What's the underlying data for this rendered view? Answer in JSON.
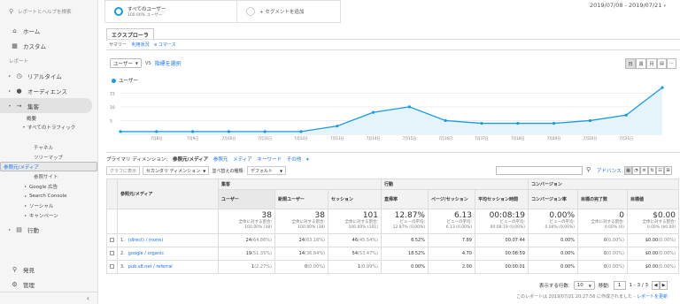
{
  "sidebar": {
    "search_placeholder": "レポートとヘルプを検索",
    "home": "ホーム",
    "custom": "カスタム",
    "reports_section": "レポート",
    "realtime": "リアルタイム",
    "audience": "オーディエンス",
    "acquisition": "集客",
    "overview": "概要",
    "all_traffic": "すべてのトラフィック",
    "channels": "チャネル",
    "treemap": "ツリーマップ",
    "source_medium": "参照元/メディア",
    "referrals": "参照サイト",
    "google_ads": "Google 広告",
    "search_console": "Search Console",
    "social": "ソーシャル",
    "campaigns": "キャンペーン",
    "behavior": "行動",
    "discover": "発見",
    "admin": "管理"
  },
  "segments": {
    "all_users_title": "すべてのユーザー",
    "all_users_sub": "100.00% ユーザー",
    "add_segment": "+ セグメントを追加"
  },
  "date_range": "2019/07/08 - 2019/07/21",
  "explorer": {
    "tab": "エクスプローラ",
    "sub_summary": "サマリー",
    "sub_usage": "利用状況",
    "sub_ecommerce": "e コマース"
  },
  "chart_controls": {
    "metric": "ユーザー",
    "vs": "VS",
    "select_metric": "指標を選択",
    "day": "日",
    "week": "週",
    "month": "月",
    "legend": "ユーザー"
  },
  "chart_data": {
    "type": "line",
    "series": [
      {
        "name": "ユーザー",
        "values": [
          1,
          1,
          1,
          1,
          1,
          1,
          3,
          8,
          10,
          5,
          4,
          4,
          4,
          5,
          7,
          17
        ]
      }
    ],
    "x": [
      "",
      "7月8日",
      "7月9日",
      "7月10日",
      "7月11日",
      "7月12日",
      "7月13日",
      "7月14日",
      "7月15日",
      "7月16日",
      "7月17日",
      "7月18日",
      "7月19日",
      "7月20日",
      "7月21日",
      ""
    ],
    "y_ticks": [
      15,
      10,
      5
    ],
    "ylim": [
      0,
      18
    ],
    "grid": true,
    "color": "#1a9be0"
  },
  "dims": {
    "primary": "プライマリ ディメンション:",
    "source_medium": "参照元/メディア",
    "source": "参照元",
    "medium": "メディア",
    "keyword": "キーワード",
    "other": "その他"
  },
  "toolbar": {
    "plot_rows": "グラフに表示",
    "secondary_dim": "セカンダリ ディメンション",
    "sort_type": "並べ替えの種類:",
    "sort_default": "デフォルト",
    "advanced": "アドバンス"
  },
  "table": {
    "dim_header": "参照元/メディア",
    "groups": {
      "acquisition": "集客",
      "behavior": "行動",
      "conversions": "コンバージョン"
    },
    "cols": [
      "ユーザー",
      "新規ユーザー",
      "セッション",
      "直帰率",
      "ページ/セッション",
      "平均セッション時間",
      "コンバージョン率",
      "目標の完了数",
      "目標値"
    ],
    "totals": [
      {
        "value": "38",
        "sub1": "全体に対する割合:",
        "sub2": "100.00% (38)"
      },
      {
        "value": "38",
        "sub1": "全体に対する割合:",
        "sub2": "100.00% (38)"
      },
      {
        "value": "101",
        "sub1": "全体に対する割合:",
        "sub2": "100.00% (101)"
      },
      {
        "value": "12.87%",
        "sub1": "ビューの平均:",
        "sub2": "12.87% (0.00%)"
      },
      {
        "value": "6.13",
        "sub1": "ビューの平均:",
        "sub2": "6.13 (0.00%)"
      },
      {
        "value": "00:08:19",
        "sub1": "ビューの平均:",
        "sub2": "00:08:19 (0.00%)"
      },
      {
        "value": "0.00%",
        "sub1": "ビューの平均:",
        "sub2": "0.00% (0.00%)"
      },
      {
        "value": "0",
        "sub1": "全体に対する割合:",
        "sub2": "0.00% (0)"
      },
      {
        "value": "$0.00",
        "sub1": "全体に対する割合:",
        "sub2": "0.00% ($0.00)"
      }
    ],
    "rows": [
      {
        "num": "1.",
        "dim": "(direct) / (none)",
        "users": "24",
        "users_pct": "(64.86%)",
        "new": "24",
        "new_pct": "(63.16%)",
        "sess": "46",
        "sess_pct": "(45.54%)",
        "bounce": "6.52%",
        "pps": "7.89",
        "dur": "00:07:44",
        "cr": "0.00%",
        "goal": "0",
        "goal_pct": "(0.00%)",
        "val": "$0.00",
        "val_pct": "(0.00%)"
      },
      {
        "num": "2.",
        "dim": "google / organic",
        "users": "19",
        "users_pct": "(51.35%)",
        "new": "14",
        "new_pct": "(36.84%)",
        "sess": "54",
        "sess_pct": "(53.47%)",
        "bounce": "18.52%",
        "pps": "4.70",
        "dur": "00:08:59",
        "cr": "0.00%",
        "goal": "0",
        "goal_pct": "(0.00%)",
        "val": "$0.00",
        "val_pct": "(0.00%)"
      },
      {
        "num": "3.",
        "dim": "pub.s8.net / referral",
        "users": "1",
        "users_pct": "(2.27%)",
        "new": "0",
        "new_pct": "(0.00%)",
        "sess": "1",
        "sess_pct": "(0.99%)",
        "bounce": "0.00%",
        "pps": "2.00",
        "dur": "00:00:01",
        "cr": "0.00%",
        "goal": "0",
        "goal_pct": "(0.00%)",
        "val": "$0.00",
        "val_pct": "(0.00%)"
      }
    ]
  },
  "pager": {
    "rows_label": "表示する行数:",
    "rows_value": "10",
    "goto_label": "移動:",
    "goto_value": "1",
    "range": "1 - 3 / 3"
  },
  "footer": {
    "text": "このレポートは 2019/07/21 20:27:56 に作成されました -",
    "refresh": "レポートを更新"
  }
}
